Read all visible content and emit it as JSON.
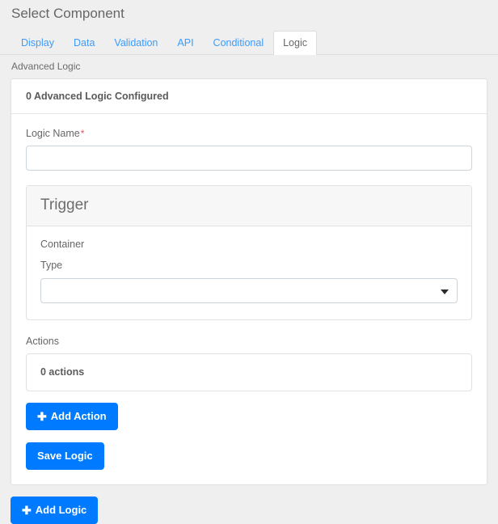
{
  "header": {
    "title": "Select Component"
  },
  "tabs": [
    {
      "label": "Display",
      "active": false
    },
    {
      "label": "Data",
      "active": false
    },
    {
      "label": "Validation",
      "active": false
    },
    {
      "label": "API",
      "active": false
    },
    {
      "label": "Conditional",
      "active": false
    },
    {
      "label": "Logic",
      "active": true
    }
  ],
  "section": {
    "label": "Advanced Logic"
  },
  "logic_card": {
    "header_text": "0 Advanced Logic Configured",
    "logic_name": {
      "label": "Logic Name",
      "required_marker": "*",
      "value": "",
      "placeholder": ""
    },
    "trigger": {
      "title": "Trigger",
      "container_label": "Container",
      "type_label": "Type",
      "type_value": "",
      "type_options": []
    },
    "actions": {
      "label": "Actions",
      "summary": "0 actions",
      "add_action_label": "Add Action",
      "add_action_icon": "plus-icon"
    },
    "save_logic_label": "Save Logic"
  },
  "footer": {
    "add_logic_label": "Add Logic",
    "add_logic_icon": "plus-icon"
  },
  "colors": {
    "primary": "#007bff",
    "link": "#3d9bfd",
    "required": "#e8505b",
    "page_bg": "#efefef",
    "card_bg": "#ffffff",
    "panel_head_bg": "#f7f7f7"
  }
}
